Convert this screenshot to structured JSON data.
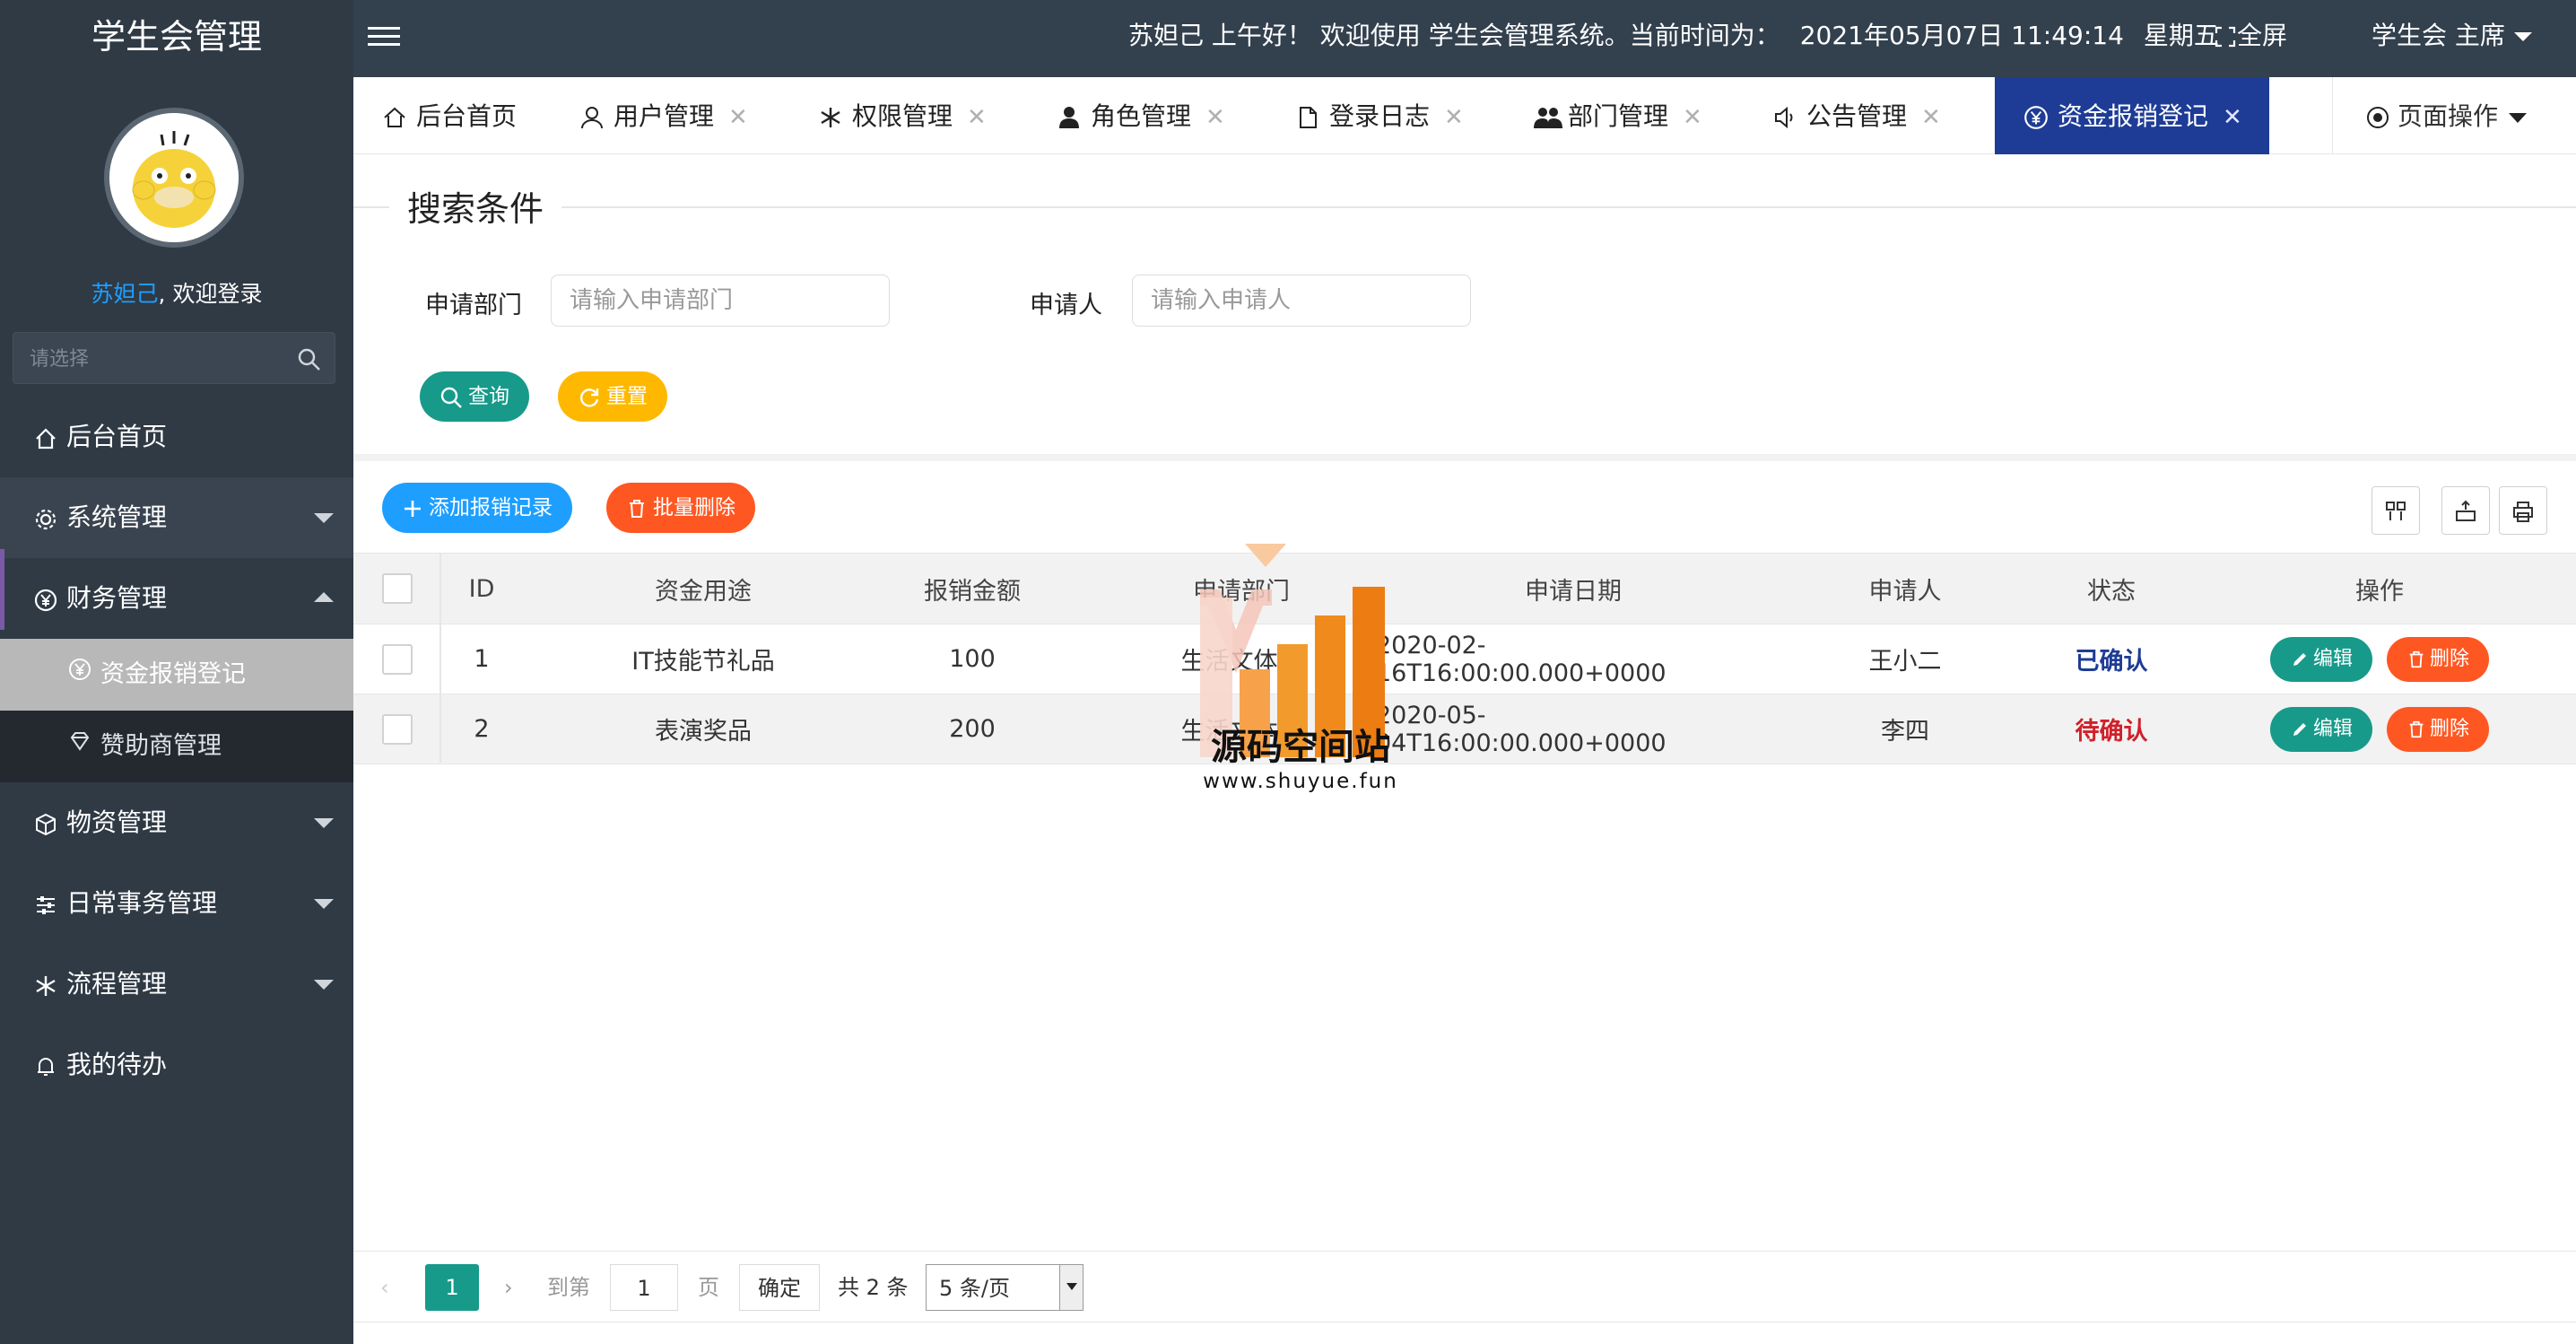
{
  "app": {
    "title": "学生会管理"
  },
  "sidebar": {
    "welcome_user": "苏妲己",
    "welcome_suffix": ", 欢迎登录",
    "search_placeholder": "请选择",
    "items": [
      {
        "label": "后台首页",
        "icon": "home-icon"
      },
      {
        "label": "系统管理",
        "icon": "gear-icon"
      },
      {
        "label": "财务管理",
        "icon": "yen-circle-icon"
      },
      {
        "label": "物资管理",
        "icon": "cube-icon"
      },
      {
        "label": "日常事务管理",
        "icon": "sliders-icon"
      },
      {
        "label": "流程管理",
        "icon": "snowflake-icon"
      },
      {
        "label": "我的待办",
        "icon": "bell-icon"
      }
    ],
    "finance_sub": [
      {
        "label": "资金报销登记",
        "icon": "yen-icon"
      },
      {
        "label": "赞助商管理",
        "icon": "diamond-icon"
      }
    ]
  },
  "header": {
    "greeting": "苏妲己 上午好！ 欢迎使用 学生会管理系统。当前时间为：",
    "datetime": "2021年05月07日 11:49:14",
    "weekday": "星期五",
    "fullscreen": "全屏",
    "role": "学生会 主席"
  },
  "tabs": [
    {
      "label": "后台首页",
      "icon": "home-icon"
    },
    {
      "label": "用户管理",
      "icon": "user-icon"
    },
    {
      "label": "权限管理",
      "icon": "snowflake-icon"
    },
    {
      "label": "角色管理",
      "icon": "person-icon"
    },
    {
      "label": "登录日志",
      "icon": "file-icon"
    },
    {
      "label": "部门管理",
      "icon": "group-icon"
    },
    {
      "label": "公告管理",
      "icon": "speaker-icon"
    },
    {
      "label": "资金报销登记",
      "icon": "yen-circle-icon"
    }
  ],
  "page_ops": "页面操作",
  "search": {
    "legend": "搜索条件",
    "dept_label": "申请部门",
    "dept_placeholder": "请输入申请部门",
    "applicant_label": "申请人",
    "applicant_placeholder": "请输入申请人",
    "query_btn": "查询",
    "reset_btn": "重置"
  },
  "toolbar": {
    "add_btn": "添加报销记录",
    "batch_delete_btn": "批量删除"
  },
  "table": {
    "headers": [
      "ID",
      "资金用途",
      "报销金额",
      "申请部门",
      "申请日期",
      "申请人",
      "状态",
      "操作"
    ],
    "rows": [
      {
        "id": "1",
        "purpose": "IT技能节礼品",
        "amount": "100",
        "dept": "生活文体部",
        "date": "2020-02-16T16:00:00.000+0000",
        "applicant": "王小二",
        "status": "已确认"
      },
      {
        "id": "2",
        "purpose": "表演奖品",
        "amount": "200",
        "dept": "生活文体部",
        "date": "2020-05-04T16:00:00.000+0000",
        "applicant": "李四",
        "status": "待确认"
      }
    ],
    "edit_btn": "编辑",
    "delete_btn": "删除"
  },
  "pager": {
    "current": "1",
    "goto_label": "到第",
    "goto_value": "1",
    "page_unit": "页",
    "confirm": "确定",
    "total": "共 2 条",
    "page_size": "5 条/页"
  },
  "watermark": {
    "text": "源码空间站",
    "url": "www.shuyue.fun"
  },
  "colors": {
    "sidebar": "#2f3a45",
    "header": "#33404e",
    "active_tab": "#1e3c96",
    "teal": "#179a8a",
    "orange": "#ff5722",
    "yellow": "#ffb800",
    "blue": "#1e9fff"
  }
}
